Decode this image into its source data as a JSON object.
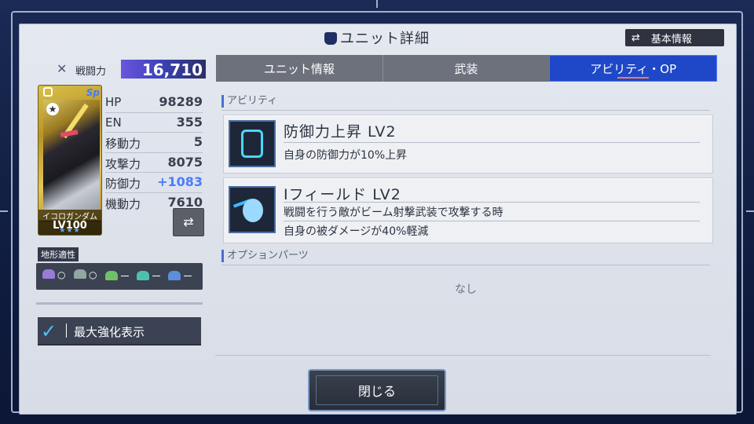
{
  "header": {
    "title": "ユニット詳細",
    "title_icon": "gundam-head-icon",
    "basic_info_button": "基本情報",
    "basic_info_icon": "shuffle-icon"
  },
  "unit": {
    "combat_power_label": "戦闘力",
    "combat_power_value": "16,710",
    "card_name": "イコロガンダム",
    "card_level": "LV100",
    "card_stars": "★★★",
    "card_sp": "Sp",
    "stats": [
      {
        "label": "HP",
        "value": "98289",
        "boosted": false
      },
      {
        "label": "EN",
        "value": "355",
        "boosted": false
      },
      {
        "label": "移動力",
        "value": "5",
        "boosted": false
      },
      {
        "label": "攻撃力",
        "value": "8075",
        "boosted": false
      },
      {
        "label": "防御力",
        "value": "+1083",
        "boosted": true
      },
      {
        "label": "機動力",
        "value": "7610",
        "boosted": false
      }
    ]
  },
  "terrain": {
    "label": "地形適性",
    "cells": [
      {
        "icon": "space-icon",
        "rank": "○",
        "color": "#9b7bd8"
      },
      {
        "icon": "land-icon",
        "rank": "○",
        "color": "#8fa8a0"
      },
      {
        "icon": "mountain-icon",
        "rank": "ー",
        "color": "#6fc06a"
      },
      {
        "icon": "water-icon",
        "rank": "ー",
        "color": "#4fc0b0"
      },
      {
        "icon": "underwater-icon",
        "rank": "ー",
        "color": "#5d8ed8"
      }
    ]
  },
  "max_enhance": {
    "label": "最大強化表示",
    "checked": true
  },
  "tabs": [
    {
      "label": "ユニット情報",
      "active": false
    },
    {
      "label": "武装",
      "active": false
    },
    {
      "label": "アビリティ・OP",
      "active": true
    }
  ],
  "abilities_section": {
    "heading": "アビリティ",
    "items": [
      {
        "name": "防御力上昇 LV2",
        "icon": "shield-icon",
        "lines": [
          "自身の防御力が10%上昇"
        ]
      },
      {
        "name": "Iフィールド LV2",
        "icon": "i-field-icon",
        "lines": [
          "戦闘を行う敵がビーム射撃武装で攻撃する時",
          "自身の被ダメージが40%軽減"
        ]
      }
    ]
  },
  "options_section": {
    "heading": "オプションパーツ",
    "empty_text": "なし"
  },
  "close_button": "閉じる"
}
